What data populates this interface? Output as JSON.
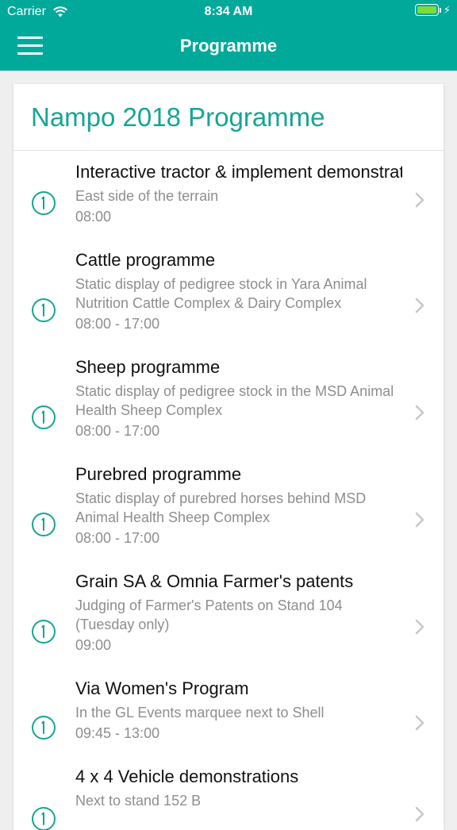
{
  "status_bar": {
    "carrier": "Carrier",
    "time": "8:34 AM",
    "charging_symbol": "⚡"
  },
  "nav": {
    "title": "Programme",
    "menu_icon": "hamburger-menu-icon"
  },
  "colors": {
    "accent": "#00a99a",
    "title_teal": "#16a594",
    "battery": "#7ddc3a",
    "secondary_text": "#8e8e8e"
  },
  "programme": {
    "heading": "Nampo 2018 Programme",
    "items": [
      {
        "title": "Interactive tractor & implement demonstrations",
        "description": "East side of the terrain",
        "time": "08:00"
      },
      {
        "title": "Cattle programme",
        "description": "Static display of pedigree stock in Yara Animal Nutrition Cattle Complex & Dairy Complex",
        "time": "08:00 - 17:00"
      },
      {
        "title": "Sheep programme",
        "description": "Static display of pedigree stock in the MSD Animal Health Sheep Complex",
        "time": "08:00 - 17:00"
      },
      {
        "title": "Purebred programme",
        "description": "Static display of purebred horses behind MSD Animal Health Sheep Complex",
        "time": "08:00 - 17:00"
      },
      {
        "title": "Grain SA & Omnia Farmer's patents",
        "description": "Judging of Farmer's Patents on Stand 104 (Tuesday only)",
        "time": "09:00"
      },
      {
        "title": "Via Women's Program",
        "description": "In the GL Events marquee next to Shell",
        "time": "09:45 - 13:00"
      },
      {
        "title": "4 x 4 Vehicle demonstrations",
        "description": "Next to stand 152 B",
        "time": ""
      }
    ]
  }
}
